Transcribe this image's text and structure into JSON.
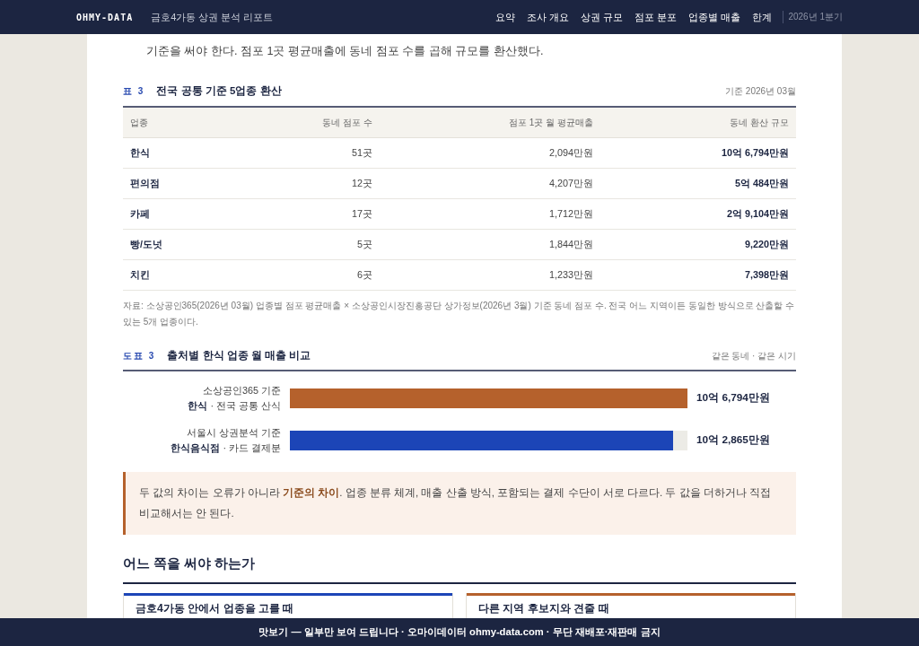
{
  "header": {
    "logo": "OHMY-DATA",
    "title": "금호4가동 상권 분석 리포트",
    "nav": [
      {
        "label": "요약"
      },
      {
        "label": "조사 개요"
      },
      {
        "label": "상권 규모"
      },
      {
        "label": "점포 분포"
      },
      {
        "label": "업종별 매출"
      },
      {
        "label": "한계"
      }
    ],
    "period": "2026년 1분기"
  },
  "intro": {
    "text": "기준을 써야 한다. 점포 1곳 평균매출에 동네 점포 수를 곱해 규모를 환산했다."
  },
  "table": {
    "label": "표 3",
    "title": "전국 공통 기준 5업종 환산",
    "note": "기준 2026년 03월",
    "columns": [
      "업종",
      "동네 점포 수",
      "점포 1곳 월 평균매출",
      "동네 환산 규모"
    ],
    "rows": [
      [
        "한식",
        "51곳",
        "2,094만원",
        "10억 6,794만원"
      ],
      [
        "편의점",
        "12곳",
        "4,207만원",
        "5억 484만원"
      ],
      [
        "카페",
        "17곳",
        "1,712만원",
        "2억 9,104만원"
      ],
      [
        "빵/도넛",
        "5곳",
        "1,844만원",
        "9,220만원"
      ],
      [
        "치킨",
        "6곳",
        "1,233만원",
        "7,398만원"
      ]
    ],
    "source": "자료: 소상공인365(2026년 03월) 업종별 점포 평균매출 × 소상공인시장진흥공단 상가정보(2026년 3월) 기준 동네 점포 수. 전국 어느 지역이든 동일한 방식으로 산출할 수 있는 5개 업종이다."
  },
  "comparison": {
    "label": "도표 3",
    "title": "출처별 한식 업종 월 매출 비교",
    "note": "같은 동네 · 같은 시기",
    "bars": [
      {
        "source": "소상공인365 기준",
        "detail": "**한식** · 전국 공통 산식",
        "level": 1,
        "color": "#b5612c",
        "value": "10억 6,794만원"
      },
      {
        "source": "서울시 상권분석 기준",
        "detail": "**한식음식점** · 카드 결제분",
        "level": 0.963,
        "color": "#1c45b7",
        "value": "10억 2,865만원"
      }
    ]
  },
  "callout": {
    "text": "두 값의 차이는 오류가 아니라 **기준의 차이**. 업종 분류 체계, 매출 산출 방식, 포함되는 결제 수단이 서로 다르다. 두 값을 더하거나 직접 비교해서는 안 된다."
  },
  "section": {
    "heading": "어느 쪽을 써야 하는가",
    "cards": [
      {
        "title": "금호4가동 안에서 업종을 고를 때",
        "color": "#1c45b7"
      },
      {
        "title": "다른 지역 후보지와 견줄 때",
        "color": "#b5612c"
      }
    ]
  },
  "footer": {
    "text": "맛보기 — 일부만 보여 드립니다 · 오마이데이터 ohmy-data.com · 무단 재배포·재판매 금지"
  }
}
